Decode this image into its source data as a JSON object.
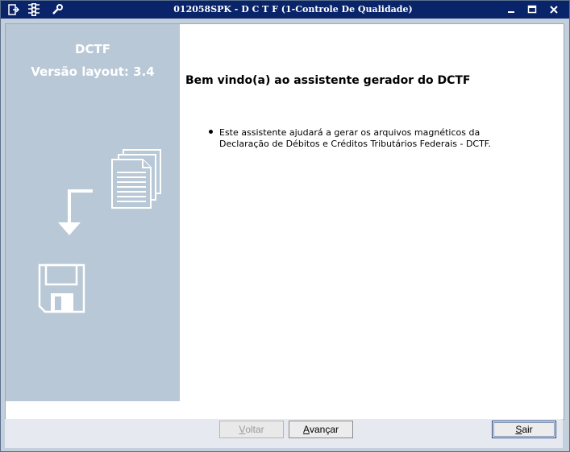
{
  "window": {
    "title": "012058SPK - D C T F (1-Controle De Qualidade)"
  },
  "titlebar_icons": [
    "exit-icon",
    "traffic-light-icon",
    "wrench-icon"
  ],
  "left_panel": {
    "title": "DCTF",
    "subtitle": "Versão layout: 3.4"
  },
  "main": {
    "heading": "Bem vindo(a) ao assistente gerador do DCTF",
    "bullet_line1": "Este assistente ajudará a gerar os arquivos magnéticos da",
    "bullet_line2": "Declaração de Débitos e Créditos Tributários Federais - DCTF."
  },
  "buttons": {
    "back_first": "V",
    "back_rest": "oltar",
    "next_first": "A",
    "next_rest": "vançar",
    "exit_first": "S",
    "exit_rest": "air"
  },
  "colors": {
    "titlebar": "#0a246a",
    "left_panel": "#b8c8d6",
    "window_bg": "#c4cfdc"
  }
}
